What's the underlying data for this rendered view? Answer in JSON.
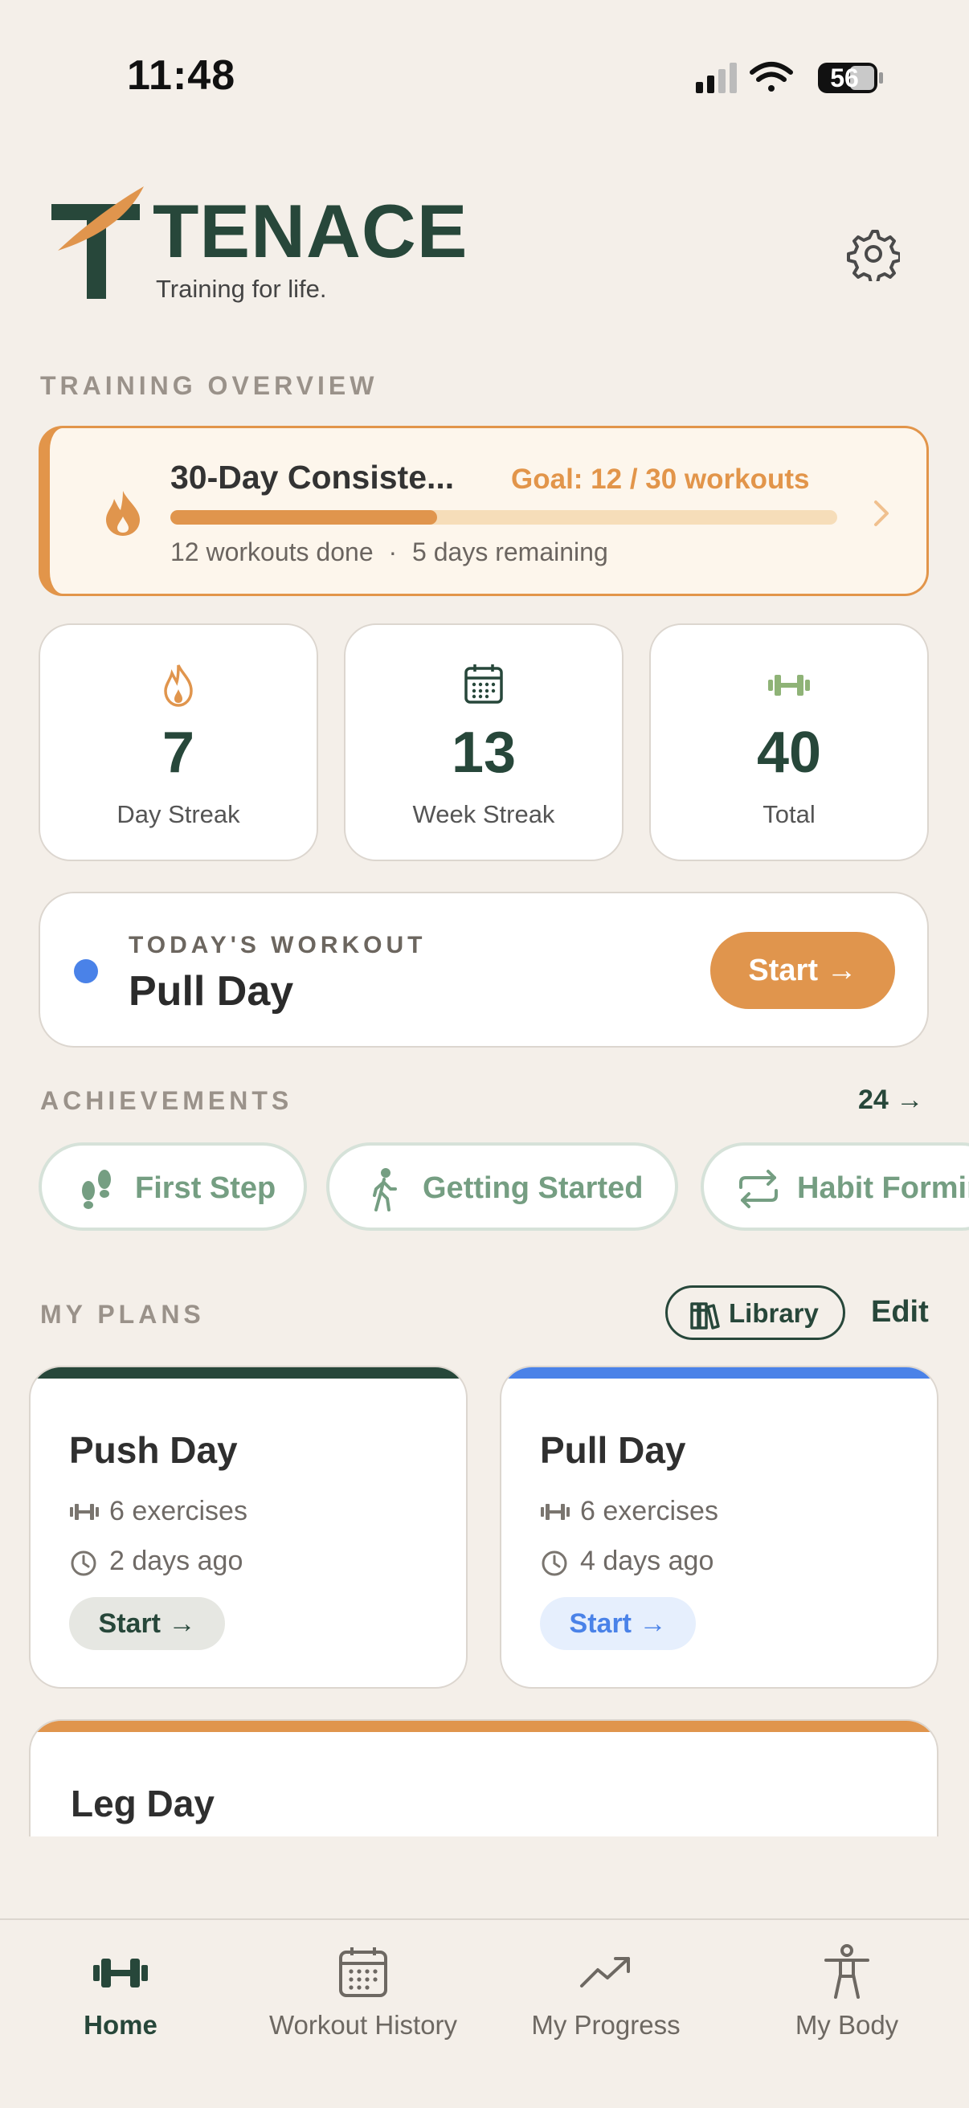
{
  "status_bar": {
    "time": "11:48",
    "battery": "56"
  },
  "header": {
    "brand": "TENACE",
    "tagline": "Training for life."
  },
  "overview": {
    "section_label": "TRAINING OVERVIEW",
    "consistency": {
      "title": "30-Day Consiste...",
      "goal": "Goal: 12 / 30 workouts",
      "done": "12 workouts done",
      "separator": "·",
      "remaining": "5 days remaining",
      "progress": 0.4
    },
    "stats": [
      {
        "value": "7",
        "label": "Day Streak",
        "icon": "flame-icon"
      },
      {
        "value": "13",
        "label": "Week Streak",
        "icon": "calendar-icon"
      },
      {
        "value": "40",
        "label": "Total",
        "icon": "dumbbell-icon"
      }
    ]
  },
  "today": {
    "label": "TODAY'S WORKOUT",
    "name": "Pull Day",
    "start": "Start →"
  },
  "achievements": {
    "section_label": "ACHIEVEMENTS",
    "count": "24 →",
    "items": [
      {
        "label": "First Step",
        "icon": "footprints-icon"
      },
      {
        "label": "Getting Started",
        "icon": "walking-icon"
      },
      {
        "label": "Habit Forming",
        "icon": "repeat-icon"
      }
    ]
  },
  "plans": {
    "section_label": "MY PLANS",
    "library": "Library",
    "edit": "Edit",
    "items": [
      {
        "name": "Push Day",
        "exercises": "6 exercises",
        "last": "2 days ago",
        "start": "Start →",
        "accent": "#27473A"
      },
      {
        "name": "Pull Day",
        "exercises": "6 exercises",
        "last": "4 days ago",
        "start": "Start →",
        "accent": "#4A82E8"
      },
      {
        "name": "Leg Day",
        "accent": "#E0954D"
      }
    ]
  },
  "tabs": [
    {
      "label": "Home",
      "icon": "dumbbell-icon",
      "active": true
    },
    {
      "label": "Workout History",
      "icon": "calendar-icon"
    },
    {
      "label": "My Progress",
      "icon": "trend-icon"
    },
    {
      "label": "My Body",
      "icon": "body-icon"
    }
  ],
  "colors": {
    "brand": "#27473A",
    "accent": "#E0954D",
    "blue": "#4A82E8",
    "background": "#F4EFE9"
  }
}
